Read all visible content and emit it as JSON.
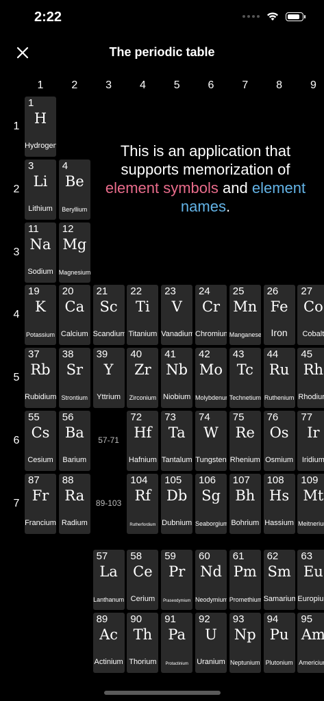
{
  "status": {
    "time": "2:22"
  },
  "header": {
    "title": "The periodic table"
  },
  "intro": {
    "part1": "This is an application that supports memorization of ",
    "highlight1": "element symbols",
    "part2": " and ",
    "highlight2": "element names",
    "part3": ".",
    "color1": "#e96c8b",
    "color2": "#63b3e6"
  },
  "columns": [
    "1",
    "2",
    "3",
    "4",
    "5",
    "6",
    "7",
    "8",
    "9"
  ],
  "rows": [
    "1",
    "2",
    "3",
    "4",
    "5",
    "6",
    "7"
  ],
  "ranges": {
    "lanthanides": "57-71",
    "actinides": "89-103"
  },
  "elements": [
    {
      "n": "1",
      "s": "H",
      "name": "Hydrogen",
      "col": 1,
      "row": 1
    },
    {
      "n": "3",
      "s": "Li",
      "name": "Lithium",
      "col": 1,
      "row": 2
    },
    {
      "n": "4",
      "s": "Be",
      "name": "Beryllium",
      "col": 2,
      "row": 2
    },
    {
      "n": "11",
      "s": "Na",
      "name": "Sodium",
      "col": 1,
      "row": 3
    },
    {
      "n": "12",
      "s": "Mg",
      "name": "Magnesium",
      "col": 2,
      "row": 3
    },
    {
      "n": "19",
      "s": "K",
      "name": "Potassium",
      "col": 1,
      "row": 4
    },
    {
      "n": "20",
      "s": "Ca",
      "name": "Calcium",
      "col": 2,
      "row": 4
    },
    {
      "n": "21",
      "s": "Sc",
      "name": "Scandium",
      "col": 3,
      "row": 4
    },
    {
      "n": "22",
      "s": "Ti",
      "name": "Titanium",
      "col": 4,
      "row": 4
    },
    {
      "n": "23",
      "s": "V",
      "name": "Vanadium",
      "col": 5,
      "row": 4
    },
    {
      "n": "24",
      "s": "Cr",
      "name": "Chromium",
      "col": 6,
      "row": 4
    },
    {
      "n": "25",
      "s": "Mn",
      "name": "Manganese",
      "col": 7,
      "row": 4
    },
    {
      "n": "26",
      "s": "Fe",
      "name": "Iron",
      "col": 8,
      "row": 4
    },
    {
      "n": "27",
      "s": "Co",
      "name": "Cobalt",
      "col": 9,
      "row": 4
    },
    {
      "n": "37",
      "s": "Rb",
      "name": "Rubidium",
      "col": 1,
      "row": 5
    },
    {
      "n": "38",
      "s": "Sr",
      "name": "Strontium",
      "col": 2,
      "row": 5
    },
    {
      "n": "39",
      "s": "Y",
      "name": "Yttrium",
      "col": 3,
      "row": 5
    },
    {
      "n": "40",
      "s": "Zr",
      "name": "Zirconium",
      "col": 4,
      "row": 5
    },
    {
      "n": "41",
      "s": "Nb",
      "name": "Niobium",
      "col": 5,
      "row": 5
    },
    {
      "n": "42",
      "s": "Mo",
      "name": "Molybdenum",
      "col": 6,
      "row": 5
    },
    {
      "n": "43",
      "s": "Tc",
      "name": "Technetium",
      "col": 7,
      "row": 5
    },
    {
      "n": "44",
      "s": "Ru",
      "name": "Ruthenium",
      "col": 8,
      "row": 5
    },
    {
      "n": "45",
      "s": "Rh",
      "name": "Rhodium",
      "col": 9,
      "row": 5
    },
    {
      "n": "55",
      "s": "Cs",
      "name": "Cesium",
      "col": 1,
      "row": 6
    },
    {
      "n": "56",
      "s": "Ba",
      "name": "Barium",
      "col": 2,
      "row": 6
    },
    {
      "n": "72",
      "s": "Hf",
      "name": "Hafnium",
      "col": 4,
      "row": 6
    },
    {
      "n": "73",
      "s": "Ta",
      "name": "Tantalum",
      "col": 5,
      "row": 6
    },
    {
      "n": "74",
      "s": "W",
      "name": "Tungsten",
      "col": 6,
      "row": 6
    },
    {
      "n": "75",
      "s": "Re",
      "name": "Rhenium",
      "col": 7,
      "row": 6
    },
    {
      "n": "76",
      "s": "Os",
      "name": "Osmium",
      "col": 8,
      "row": 6
    },
    {
      "n": "77",
      "s": "Ir",
      "name": "Iridium",
      "col": 9,
      "row": 6
    },
    {
      "n": "87",
      "s": "Fr",
      "name": "Francium",
      "col": 1,
      "row": 7
    },
    {
      "n": "88",
      "s": "Ra",
      "name": "Radium",
      "col": 2,
      "row": 7
    },
    {
      "n": "104",
      "s": "Rf",
      "name": "Rutherfordium",
      "col": 4,
      "row": 7
    },
    {
      "n": "105",
      "s": "Db",
      "name": "Dubnium",
      "col": 5,
      "row": 7
    },
    {
      "n": "106",
      "s": "Sg",
      "name": "Seaborgium",
      "col": 6,
      "row": 7
    },
    {
      "n": "107",
      "s": "Bh",
      "name": "Bohrium",
      "col": 7,
      "row": 7
    },
    {
      "n": "108",
      "s": "Hs",
      "name": "Hassium",
      "col": 8,
      "row": 7
    },
    {
      "n": "109",
      "s": "Mt",
      "name": "Meitnerium",
      "col": 9,
      "row": 7
    },
    {
      "n": "57",
      "s": "La",
      "name": "Lanthanum",
      "col": 3,
      "row": 8
    },
    {
      "n": "58",
      "s": "Ce",
      "name": "Cerium",
      "col": 4,
      "row": 8
    },
    {
      "n": "59",
      "s": "Pr",
      "name": "Praseodymium",
      "col": 5,
      "row": 8
    },
    {
      "n": "60",
      "s": "Nd",
      "name": "Neodymium",
      "col": 6,
      "row": 8
    },
    {
      "n": "61",
      "s": "Pm",
      "name": "Promethium",
      "col": 7,
      "row": 8
    },
    {
      "n": "62",
      "s": "Sm",
      "name": "Samarium",
      "col": 8,
      "row": 8
    },
    {
      "n": "63",
      "s": "Eu",
      "name": "Europium",
      "col": 9,
      "row": 8
    },
    {
      "n": "89",
      "s": "Ac",
      "name": "Actinium",
      "col": 3,
      "row": 9
    },
    {
      "n": "90",
      "s": "Th",
      "name": "Thorium",
      "col": 4,
      "row": 9
    },
    {
      "n": "91",
      "s": "Pa",
      "name": "Protactinium",
      "col": 5,
      "row": 9
    },
    {
      "n": "92",
      "s": "U",
      "name": "Uranium",
      "col": 6,
      "row": 9
    },
    {
      "n": "93",
      "s": "Np",
      "name": "Neptunium",
      "col": 7,
      "row": 9
    },
    {
      "n": "94",
      "s": "Pu",
      "name": "Plutonium",
      "col": 8,
      "row": 9
    },
    {
      "n": "95",
      "s": "Am",
      "name": "Americium",
      "col": 9,
      "row": 9
    }
  ]
}
